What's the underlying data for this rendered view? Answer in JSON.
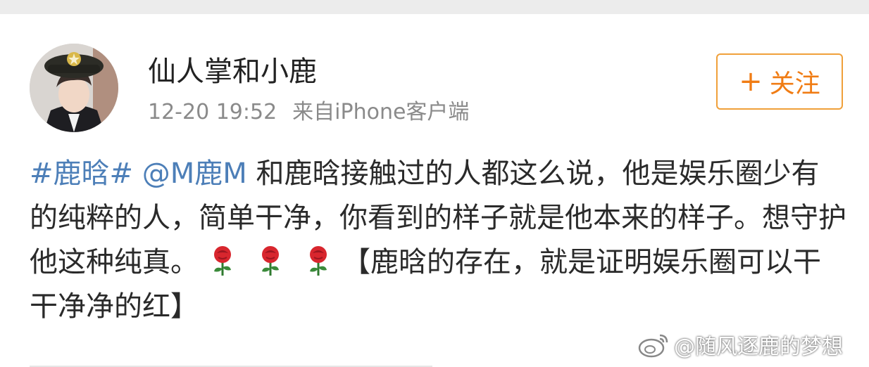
{
  "post": {
    "username": "仙人掌和小鹿",
    "timestamp": "12-20 19:52",
    "source": "来自iPhone客户端",
    "follow_plus": "+",
    "follow_label": "关注",
    "hashtag": "#鹿晗#",
    "mention": "@M鹿M",
    "text_part1": " 和鹿晗接触过的人都这么说，他是娱乐圈少有的纯粹的人，简单干净，你看到的样子就是他本来的样子。想守护他这种纯真。",
    "text_part2": "【鹿晗的存在，就是证明娱乐圈可以干干净净的红】",
    "emoji": [
      "rose",
      "rose",
      "rose"
    ]
  },
  "watermark": {
    "text": "@随风逐鹿的梦想",
    "icon": "weibo-logo-icon"
  },
  "colors": {
    "link": "#4d7fb8",
    "follow": "#f07c14",
    "meta": "#8a8a8a"
  }
}
